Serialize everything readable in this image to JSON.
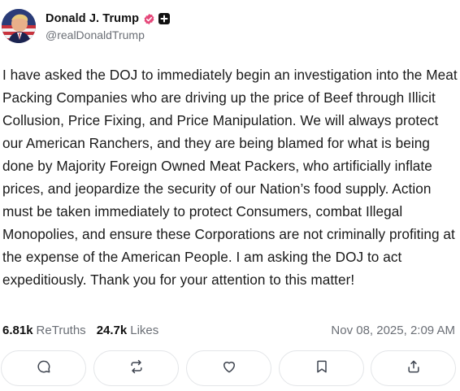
{
  "author": {
    "display_name": "Donald J. Trump",
    "handle": "@realDonaldTrump",
    "avatar_icon": "profile-avatar",
    "verified_icon": "verified-badge-icon",
    "plus_icon": "plus-badge-icon"
  },
  "post": {
    "text": "I have asked the DOJ to immediately begin an investigation into the Meat Packing Companies who are driving up the price of Beef through Illicit Collusion, Price Fixing, and Price Manipulation. We will always protect our American Ranchers, and they are being blamed for what is being done by Majority Foreign Owned Meat Packers, who artificially inflate prices, and jeopardize the security of our Nation’s food supply. Action must be taken immediately to protect Consumers, combat Illegal Monopolies, and ensure these Corporations are not criminally profiting at the expense of the American People. I am asking the DOJ to act expeditiously. Thank you for your attention to this matter!"
  },
  "stats": {
    "retruths_count": "6.81k",
    "retruths_label": "ReTruths",
    "likes_count": "24.7k",
    "likes_label": "Likes",
    "timestamp": "Nov 08, 2025, 2:09 AM"
  },
  "actions": [
    {
      "name": "reply",
      "icon": "comment-icon"
    },
    {
      "name": "retruth",
      "icon": "repost-icon"
    },
    {
      "name": "like",
      "icon": "heart-icon"
    },
    {
      "name": "bookmark",
      "icon": "bookmark-icon"
    },
    {
      "name": "share",
      "icon": "share-icon"
    }
  ],
  "colors": {
    "verified": "#e5487a",
    "muted_text": "#6b6f76",
    "border": "#e3e5e8",
    "icon": "#3f4550"
  }
}
